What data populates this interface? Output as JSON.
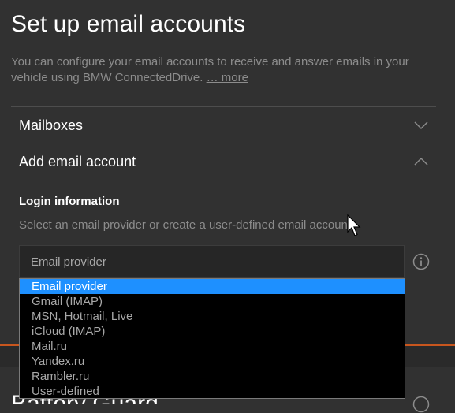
{
  "page": {
    "title": "Set up email accounts",
    "intro_text": "You can configure your email accounts to receive and answer emails in your vehicle using BMW ConnectedDrive.",
    "more_link": "… more"
  },
  "sections": {
    "mailboxes": {
      "label": "Mailboxes",
      "state": "collapsed"
    },
    "add_account": {
      "label": "Add email account",
      "state": "expanded"
    }
  },
  "login": {
    "heading": "Login information",
    "description": "Select an email provider or create a user-defined email account."
  },
  "provider_select": {
    "value": "Email provider",
    "options": [
      "Email provider",
      "Gmail (IMAP)",
      "MSN, Hotmail, Live",
      "iCloud (IMAP)",
      "Mail.ru",
      "Yandex.ru",
      "Rambler.ru",
      "User-defined"
    ],
    "highlighted_option": "Email provider"
  },
  "next_section": {
    "label": "Battery Guard"
  },
  "icons": {
    "mailboxes_toggle": "chevron-down-icon",
    "add_account_toggle": "chevron-up-icon",
    "info": "info-icon",
    "cursor": "mouse-pointer-icon"
  },
  "colors": {
    "background": "#313131",
    "highlight": "#1e90ff",
    "accent": "#c8561e",
    "muted_text": "#8c8c8c"
  }
}
